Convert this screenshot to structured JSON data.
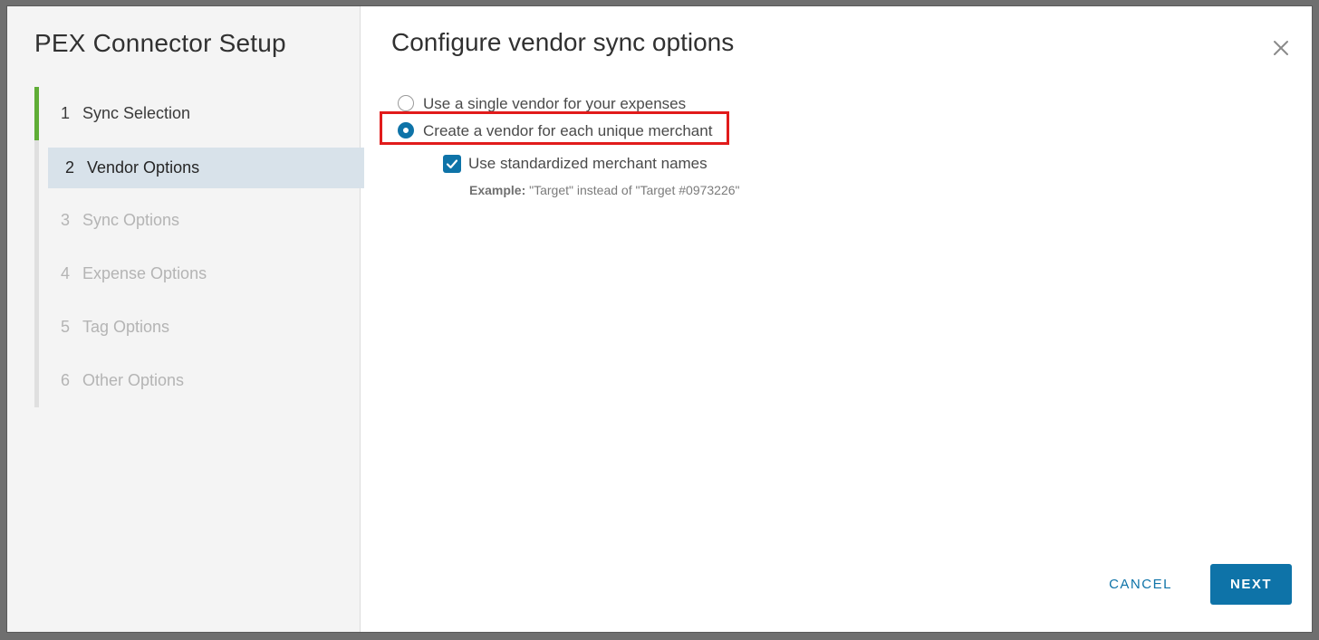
{
  "sidebar": {
    "title": "PEX Connector Setup",
    "steps": [
      {
        "num": "1",
        "label": "Sync Selection",
        "state": "done"
      },
      {
        "num": "2",
        "label": "Vendor Options",
        "state": "active"
      },
      {
        "num": "3",
        "label": "Sync Options",
        "state": "disabled"
      },
      {
        "num": "4",
        "label": "Expense Options",
        "state": "disabled"
      },
      {
        "num": "5",
        "label": "Tag Options",
        "state": "disabled"
      },
      {
        "num": "6",
        "label": "Other Options",
        "state": "disabled"
      }
    ]
  },
  "main": {
    "title": "Configure vendor sync options",
    "close_icon": "close-icon",
    "options": {
      "radio_single": {
        "label": "Use a single vendor for your expenses",
        "selected": false
      },
      "radio_each": {
        "label": "Create a vendor for each unique merchant",
        "selected": true
      },
      "checkbox_standardized": {
        "label": "Use standardized merchant names",
        "checked": true
      },
      "hint": {
        "prefix": "Example:",
        "text": " \"Target\" instead of \"Target #0973226\""
      }
    }
  },
  "footer": {
    "cancel_label": "CANCEL",
    "next_label": "NEXT"
  },
  "colors": {
    "accent": "#0e73a8",
    "step_done": "#5fad36",
    "active_step_bg": "#d8e2ea",
    "highlight_box": "#e11b1b"
  }
}
